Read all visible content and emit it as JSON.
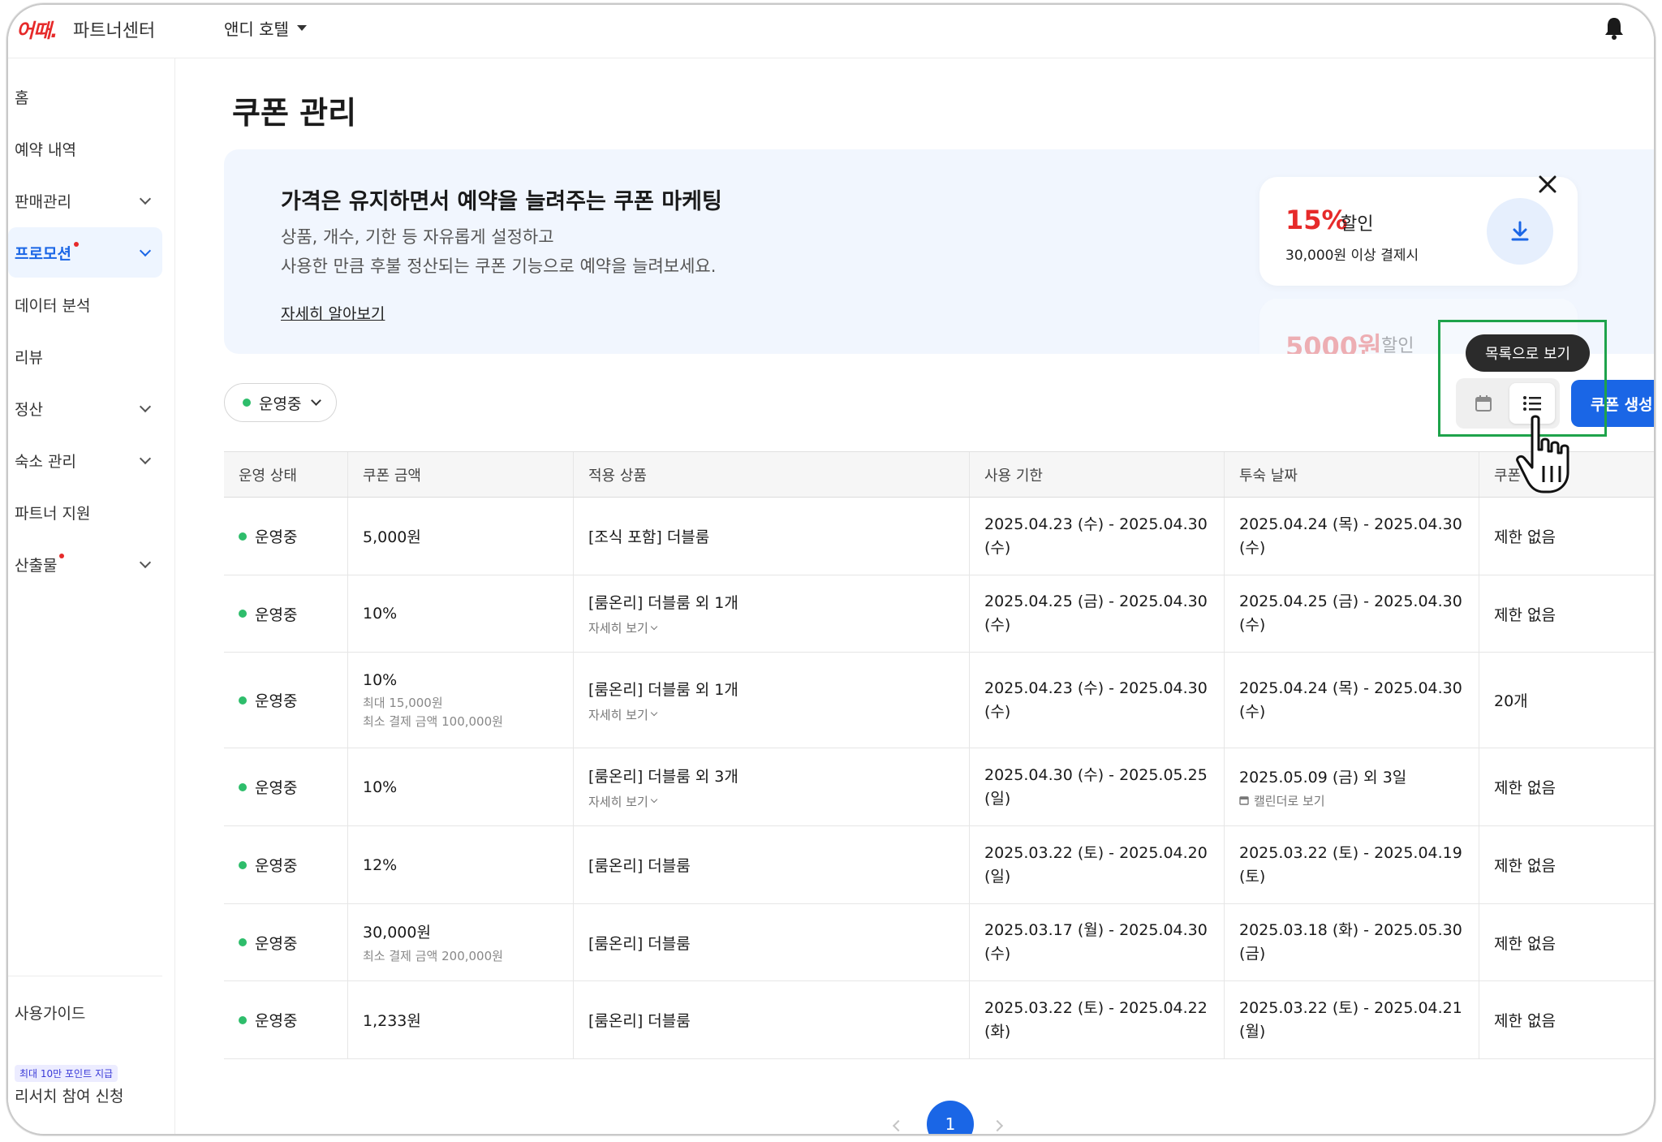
{
  "header": {
    "logo": "여기어때",
    "logo_visible": "어때.",
    "brand": "파트너센터",
    "hotel_name": "앤디 호텔"
  },
  "sidebar": {
    "items": [
      {
        "label": "홈"
      },
      {
        "label": "예약 내역"
      },
      {
        "label": "판매관리"
      },
      {
        "label": "프로모션"
      },
      {
        "label": "데이터 분석"
      },
      {
        "label": "리뷰"
      },
      {
        "label": "정산"
      },
      {
        "label": "숙소 관리"
      },
      {
        "label": "파트너 지원"
      },
      {
        "label": "산출물"
      }
    ],
    "guide": "사용가이드",
    "badge": "최대 10만 포인트 지급",
    "research": "리서치 참여 신청"
  },
  "page": {
    "title": "쿠폰 관리"
  },
  "banner": {
    "title": "가격은 유지하면서 예약을 늘려주는 쿠폰 마케팅",
    "desc_line1": "상품, 개수, 기한 등 자유롭게 설정하고",
    "desc_line2": "사용한 만큼 후불 정산되는 쿠폰 기능으로 예약을 늘려보세요.",
    "link": "자세히 알아보기",
    "card1": {
      "value": "15%",
      "suffix": "할인",
      "sub": "30,000원 이상 결제시"
    },
    "card2": {
      "value": "5000원",
      "suffix": "할인"
    }
  },
  "toolbar": {
    "status_filter": "운영중",
    "tooltip": "목록으로 보기",
    "create_button": "쿠폰 생성"
  },
  "table": {
    "headers": [
      "운영 상태",
      "쿠폰 금액",
      "적용 상품",
      "사용 기한",
      "투숙 날짜",
      "쿠폰"
    ],
    "more_label": "자세히 보기",
    "calendar_label": "캘린더로 보기",
    "rows": [
      {
        "status": "운영중",
        "amount": "5,000원",
        "product": "[조식 포함] 더블룸",
        "use_line1": "2025.04.23 (수) - 2025.04.30",
        "use_line2": "(수)",
        "stay_line1": "2025.04.24 (목) - 2025.04.30",
        "stay_line2": "(수)",
        "limit": "제한 없음"
      },
      {
        "status": "운영중",
        "amount": "10%",
        "product": "[룸온리] 더블룸 외 1개",
        "use_line1": "2025.04.25 (금) - 2025.04.30",
        "use_line2": "(수)",
        "stay_line1": "2025.04.25 (금) - 2025.04.30",
        "stay_line2": "(수)",
        "limit": "제한 없음"
      },
      {
        "status": "운영중",
        "amount": "10%",
        "amount_sub1": "최대 15,000원",
        "amount_sub2": "최소 결제 금액 100,000원",
        "product": "[룸온리] 더블룸 외 1개",
        "use_line1": "2025.04.23 (수) - 2025.04.30",
        "use_line2": "(수)",
        "stay_line1": "2025.04.24 (목) - 2025.04.30",
        "stay_line2": "(수)",
        "limit": "20개"
      },
      {
        "status": "운영중",
        "amount": "10%",
        "product": "[룸온리] 더블룸 외 3개",
        "use_line1": "2025.04.30 (수) - 2025.05.25",
        "use_line2": "(일)",
        "stay_line1": "2025.05.09 (금) 외 3일",
        "limit": "제한 없음"
      },
      {
        "status": "운영중",
        "amount": "12%",
        "product": "[룸온리] 더블룸",
        "use_line1": "2025.03.22 (토) - 2025.04.20",
        "use_line2": "(일)",
        "stay_line1": "2025.03.22 (토) - 2025.04.19",
        "stay_line2": "(토)",
        "limit": "제한 없음"
      },
      {
        "status": "운영중",
        "amount": "30,000원",
        "amount_sub1": "최소 결제 금액 200,000원",
        "product": "[룸온리] 더블룸",
        "use_line1": "2025.03.17 (월) - 2025.04.30",
        "use_line2": "(수)",
        "stay_line1": "2025.03.18 (화) - 2025.05.30",
        "stay_line2": "(금)",
        "limit": "제한 없음"
      },
      {
        "status": "운영중",
        "amount": "1,233원",
        "product": "[룸온리] 더블룸",
        "use_line1": "2025.03.22 (토) - 2025.04.22",
        "use_line2": "(화)",
        "stay_line1": "2025.03.22 (토) - 2025.04.21",
        "stay_line2": "(월)",
        "limit": "제한 없음"
      }
    ]
  },
  "pagination": {
    "current": "1"
  },
  "colors": {
    "accent": "#1a66e6",
    "brand_red": "#e62a2a",
    "status_green": "#2ebd6b",
    "highlight": "#1ea34b"
  }
}
